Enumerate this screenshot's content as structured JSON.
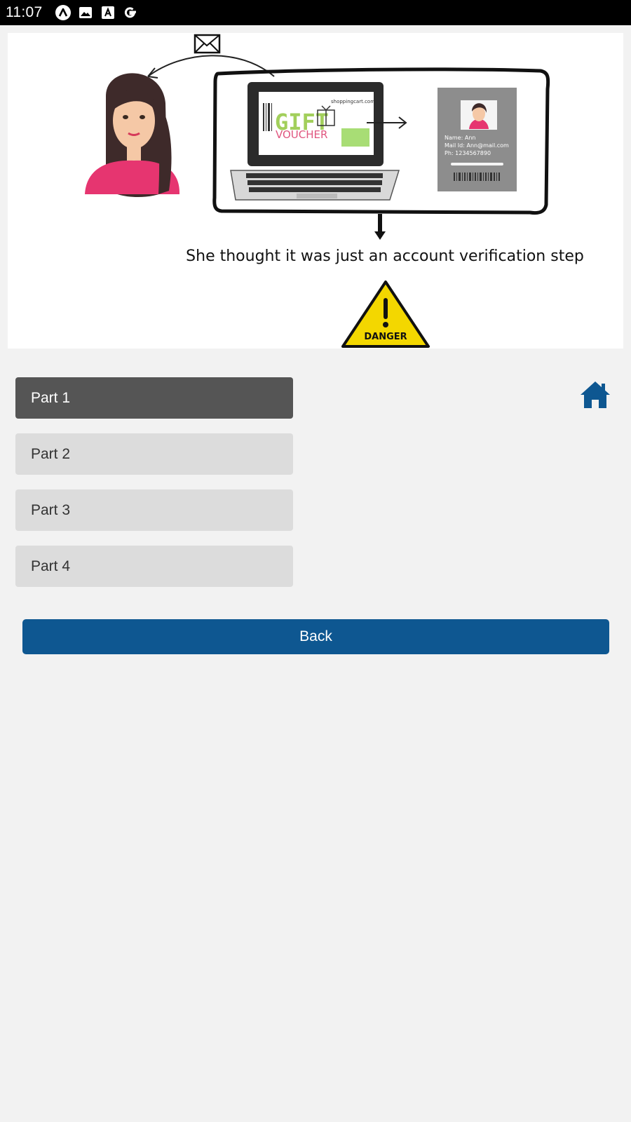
{
  "status_bar": {
    "time": "11:07",
    "icons": [
      "a-circle-icon",
      "image-icon",
      "font-icon",
      "google-icon"
    ]
  },
  "illustration": {
    "caption": "She thought it was just an account verification step",
    "voucher_site": "shoppingcart.com",
    "voucher_title_1": "GIFT",
    "voucher_title_2": "VOUCHER",
    "id_name": "Name: Ann",
    "id_mail": "Mail Id: Ann@mail.com",
    "id_phone": "Ph: 1234567890",
    "danger_label": "DANGER"
  },
  "parts": [
    {
      "label": "Part 1",
      "active": true
    },
    {
      "label": "Part 2",
      "active": false
    },
    {
      "label": "Part 3",
      "active": false
    },
    {
      "label": "Part 4",
      "active": false
    }
  ],
  "home": {
    "icon": "home-icon",
    "color": "#0e5791"
  },
  "back": {
    "label": "Back",
    "color": "#0e5791"
  }
}
